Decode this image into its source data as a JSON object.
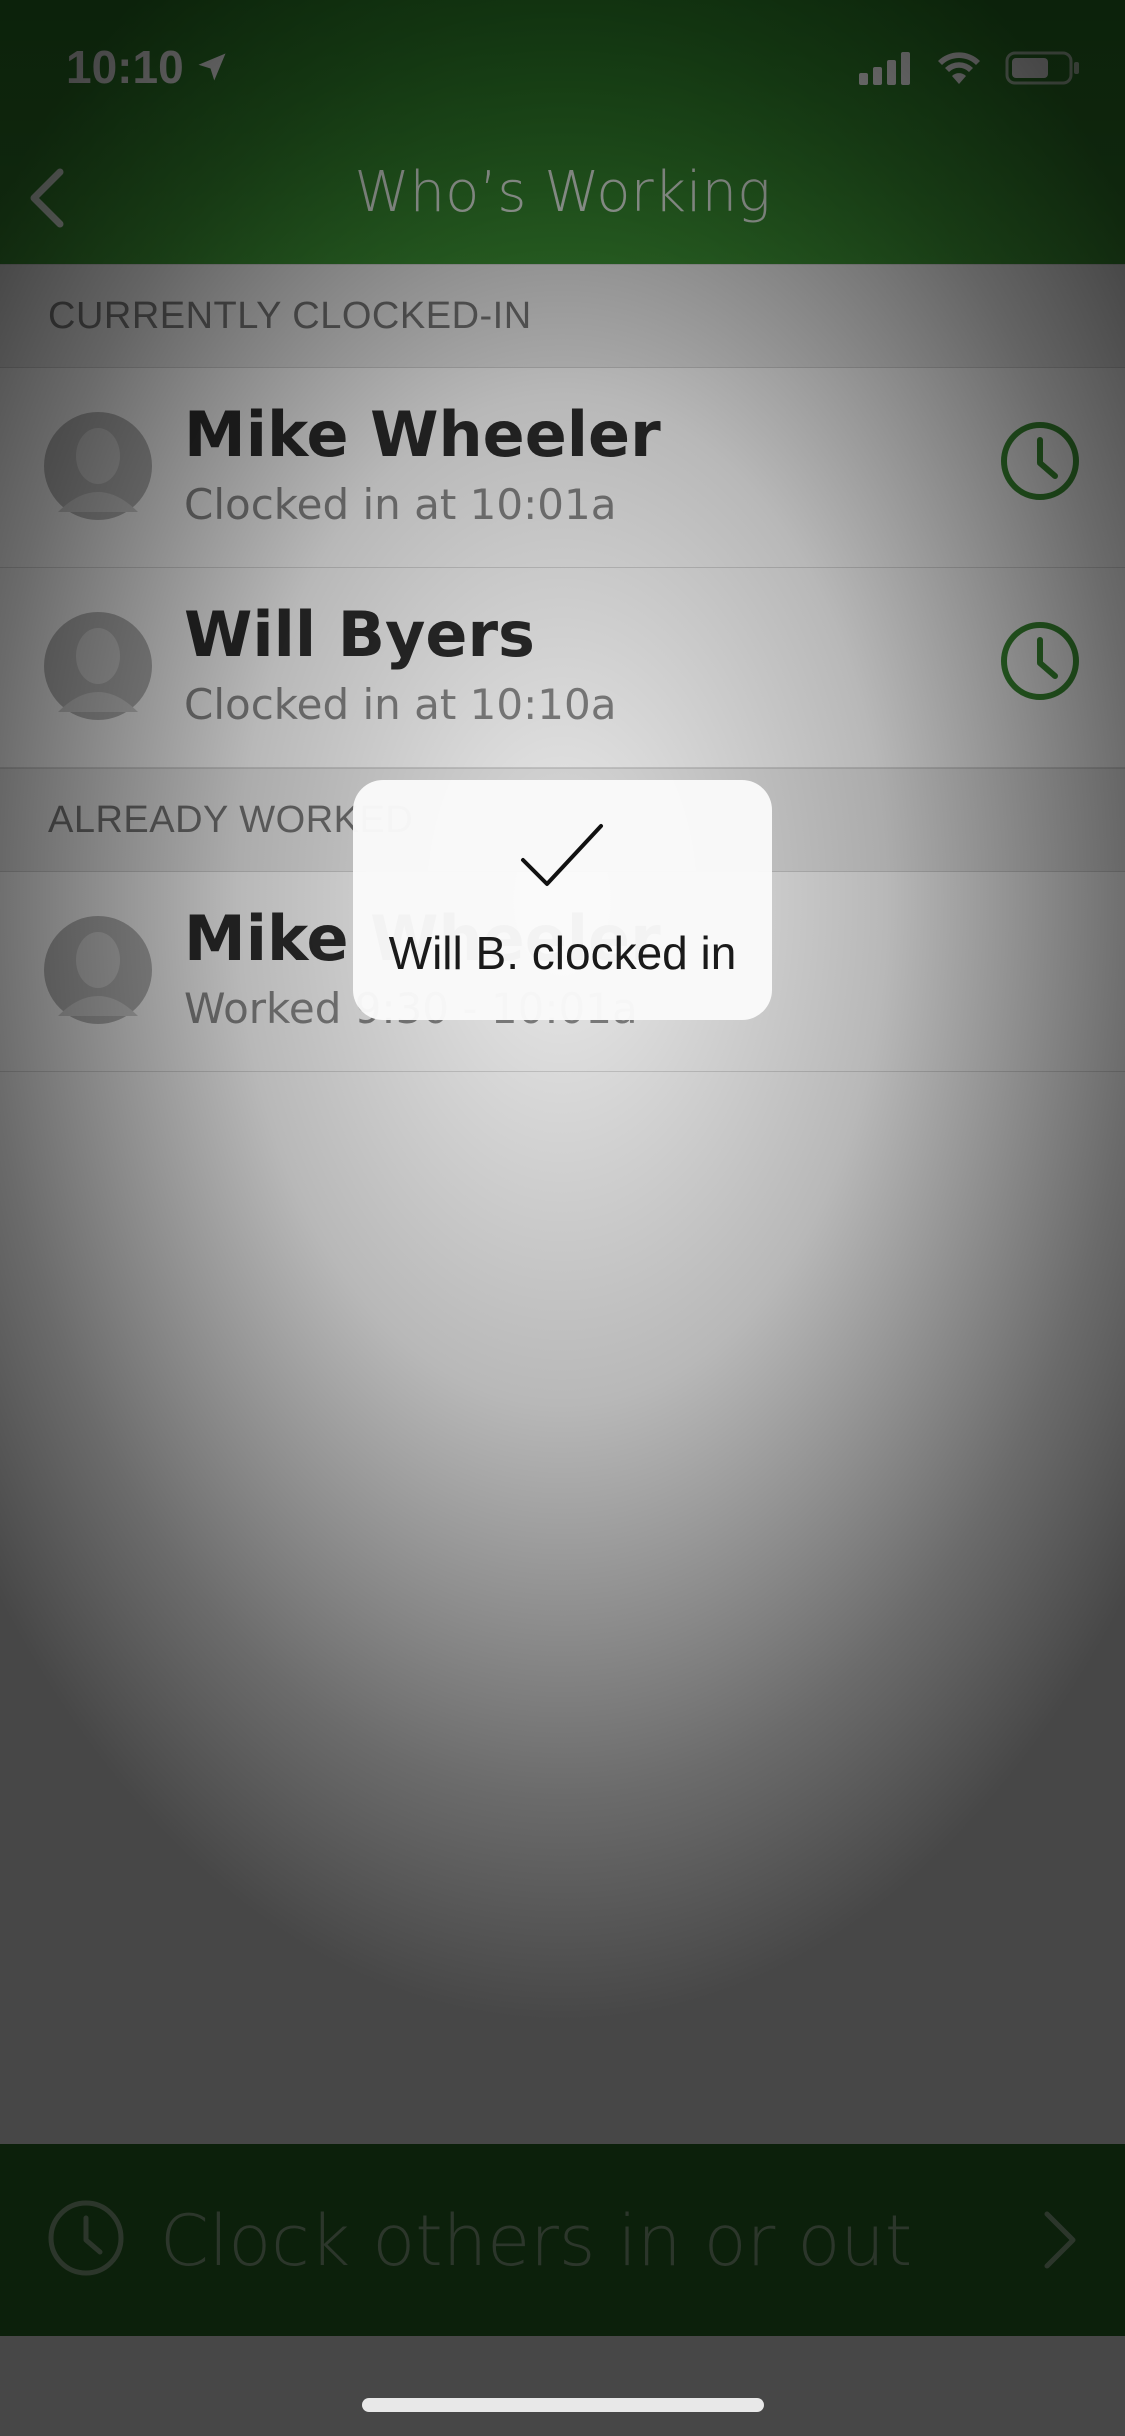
{
  "status_bar": {
    "time": "10:10"
  },
  "nav": {
    "title": "Who’s Working"
  },
  "sections": {
    "clocked_in_header": "CURRENTLY CLOCKED-IN",
    "already_worked_header": "ALREADY WORKED"
  },
  "clocked_in": [
    {
      "name": "Mike Wheeler",
      "status": "Clocked in at 10:01a"
    },
    {
      "name": "Will Byers",
      "status": "Clocked in at 10:10a"
    }
  ],
  "already_worked": [
    {
      "name": "Mike Wheeler",
      "status": "Worked 9:30 - 10:01a"
    }
  ],
  "bottom_bar": {
    "label": "Clock others in or out"
  },
  "toast": {
    "message": "Will B. clocked in"
  },
  "colors": {
    "brand_green": "#3b8f33",
    "clock_icon_green": "#3b8f33"
  }
}
